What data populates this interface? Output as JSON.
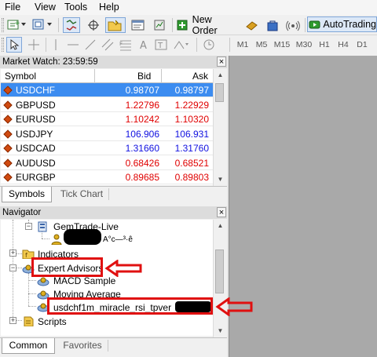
{
  "menu": [
    "File",
    "View",
    "Tools",
    "Help"
  ],
  "toolbar": {
    "new_order": "New Order",
    "autotrading": "AutoTrading",
    "timeframes": [
      "M1",
      "M5",
      "M15",
      "M30",
      "H1",
      "H4",
      "D1"
    ]
  },
  "market_watch": {
    "title": "Market Watch: 23:59:59",
    "columns": [
      "Symbol",
      "Bid",
      "Ask"
    ],
    "rows": [
      {
        "symbol": "USDCHF",
        "bid": "0.98707",
        "ask": "0.98797",
        "selected": true,
        "bid_color": "#ffffff",
        "ask_color": "#ffffff"
      },
      {
        "symbol": "GBPUSD",
        "bid": "1.22796",
        "ask": "1.22929",
        "bid_color": "#e00000",
        "ask_color": "#e00000"
      },
      {
        "symbol": "EURUSD",
        "bid": "1.10242",
        "ask": "1.10320",
        "bid_color": "#e00000",
        "ask_color": "#e00000"
      },
      {
        "symbol": "USDJPY",
        "bid": "106.906",
        "ask": "106.931",
        "bid_color": "#1010e0",
        "ask_color": "#1010e0"
      },
      {
        "symbol": "USDCAD",
        "bid": "1.31660",
        "ask": "1.31760",
        "bid_color": "#1010e0",
        "ask_color": "#1010e0"
      },
      {
        "symbol": "AUDUSD",
        "bid": "0.68426",
        "ask": "0.68521",
        "bid_color": "#e00000",
        "ask_color": "#e00000"
      },
      {
        "symbol": "EURGBP",
        "bid": "0.89685",
        "ask": "0.89803",
        "bid_color": "#e00000",
        "ask_color": "#e00000"
      }
    ],
    "tabs": [
      "Symbols",
      "Tick Chart"
    ]
  },
  "navigator": {
    "title": "Navigator",
    "items": {
      "account": "GemTrade-Live",
      "account_sub": "A°c—³·ê",
      "indicators": "Indicators",
      "expert_advisors": "Expert Advisors",
      "ea1": "MACD Sample",
      "ea2": "Moving Average",
      "ea3": "usdchf1m_miracle_rsi_tpver",
      "scripts": "Scripts"
    },
    "tabs": [
      "Common",
      "Favorites"
    ]
  },
  "colors": {
    "selection": "#3c8cf0",
    "annotation": "#e01010",
    "chart_background": "#a9a9a9"
  }
}
